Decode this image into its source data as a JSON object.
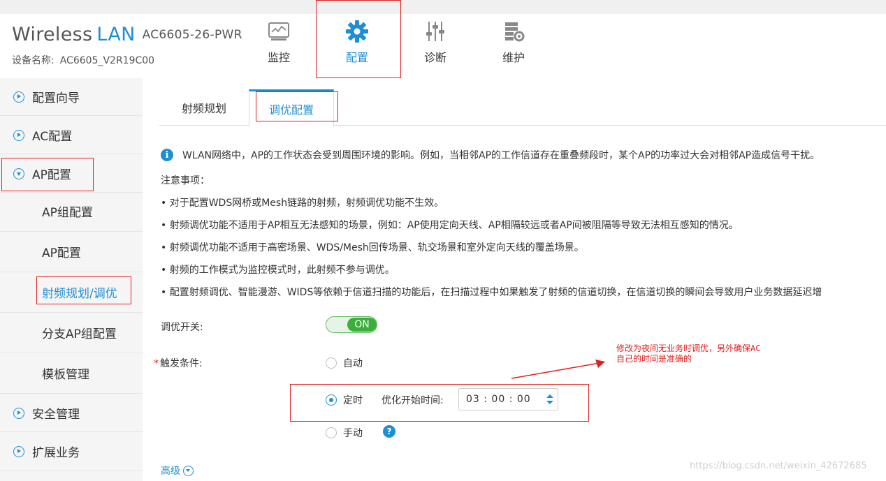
{
  "header": {
    "brand_main": "Wireless",
    "brand_accent": "LAN",
    "model": "AC6605-26-PWR",
    "device_label": "设备名称:",
    "device_value": "AC6605_V2R19C00",
    "nav": [
      {
        "label": "监控",
        "icon": "monitor-icon"
      },
      {
        "label": "配置",
        "icon": "gear-icon"
      },
      {
        "label": "诊断",
        "icon": "sliders-icon"
      },
      {
        "label": "维护",
        "icon": "maintenance-icon"
      }
    ]
  },
  "sidebar": {
    "items": [
      {
        "label": "配置向导"
      },
      {
        "label": "AC配置"
      },
      {
        "label": "AP配置"
      }
    ],
    "sub_items": [
      {
        "label": "AP组配置"
      },
      {
        "label": "AP配置"
      },
      {
        "label": "射频规划/调优"
      },
      {
        "label": "分支AP组配置"
      },
      {
        "label": "模板管理"
      }
    ],
    "bottom_items": [
      {
        "label": "安全管理"
      },
      {
        "label": "扩展业务"
      }
    ]
  },
  "tabs": [
    {
      "label": "射频规划"
    },
    {
      "label": "调优配置"
    }
  ],
  "info": {
    "main": "WLAN网络中，AP的工作状态会受到周围环境的影响。例如，当相邻AP的工作信道存在重叠频段时，某个AP的功率过大会对相邻AP造成信号干扰。",
    "notes_title": "注意事项：",
    "bullets": [
      "• 对于配置WDS网桥或Mesh链路的射频，射频调优功能不生效。",
      "• 射频调优功能不适用于AP相互无法感知的场景，例如：AP使用定向天线、AP相隔较远或者AP间被阻隔等导致无法相互感知的情况。",
      "• 射频调优功能不适用于高密场景、WDS/Mesh回传场景、轨交场景和室外定向天线的覆盖场景。",
      "• 射频的工作模式为监控模式时，此射频不参与调优。",
      "• 配置射频调优、智能漫游、WIDS等依赖于信道扫描的功能后，在扫描过程中如果触发了射频的信道切换，在信道切换的瞬间会导致用户业务数据延迟增"
    ]
  },
  "form": {
    "switch_label": "调优开关:",
    "switch_value": "ON",
    "trigger_required": "*",
    "trigger_label": "触发条件:",
    "options": [
      "自动",
      "定时",
      "手动"
    ],
    "selected_option": "定时",
    "time_label": "优化开始时间:",
    "time_value": "03 : 00 : 00",
    "help_glyph": "?",
    "advanced_label": "高级"
  },
  "annotation": {
    "line1": "修改为夜间无业务时调优，另外确保AC",
    "line2": "自己的时间是准确的"
  },
  "watermark": "https://blog.csdn.net/weixin_42672685",
  "colors": {
    "accent": "#1e8fd5",
    "highlight": "#e02020",
    "switch_on": "#3cae3c"
  }
}
